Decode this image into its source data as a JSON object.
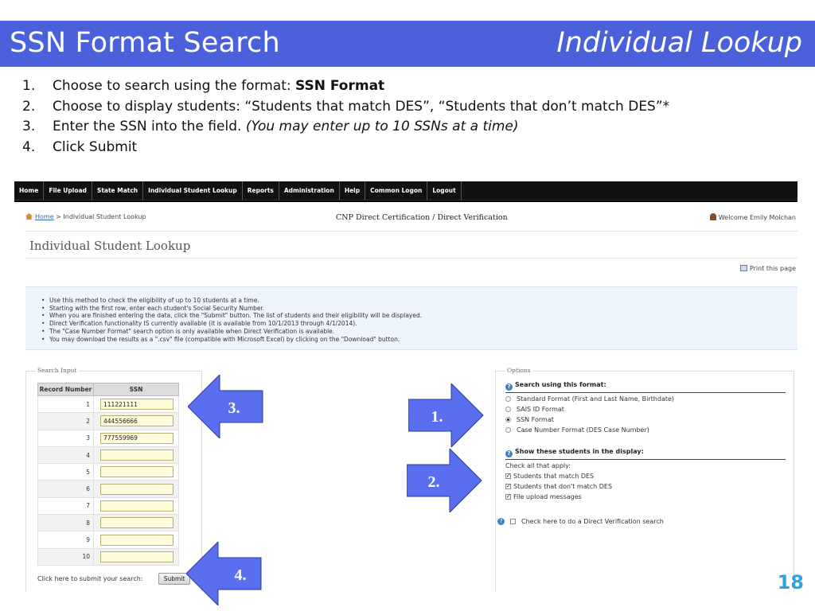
{
  "slide": {
    "title_left": "SSN Format Search",
    "title_right": "Individual Lookup",
    "page_number": "18",
    "accent_color": "#4a61db"
  },
  "steps": [
    {
      "num": "1.",
      "text": "Choose to search using the format: ",
      "bold": "SSN Format"
    },
    {
      "num": "2.",
      "text": "Choose to display students: “Students that match DES”, “Students that don’t match DES”*"
    },
    {
      "num": "3.",
      "text": "Enter the SSN into the field. ",
      "italic": "(You may enter up to 10 SSNs at a time)"
    },
    {
      "num": "4.",
      "text": "Click Submit"
    }
  ],
  "app": {
    "nav": [
      "Home",
      "File Upload",
      "State Match",
      "Individual Student Lookup",
      "Reports",
      "Administration",
      "Help",
      "Common Logon",
      "Logout"
    ],
    "breadcrumb": {
      "home": "Home",
      "separator": " > ",
      "current": "Individual Student Lookup"
    },
    "center_title": "CNP Direct Certification / Direct Verification",
    "welcome": "Welcome Emily Molchan",
    "page_heading": "Individual Student Lookup",
    "print_label": "Print this page",
    "info_bullets": [
      "Use this method to check the eligibility of up to 10 students at a time.",
      "Starting with the first row, enter each student's Social Security Number.",
      "When you are finished entering the data, click the \"Submit\" button. The list of students and their eligibility will be displayed.",
      "Direct Verification functionality IS currently available (it is available from 10/1/2013 through 4/1/2014).",
      "The \"Case Number Format\" search option is only available when Direct Verification is available.",
      "You may download the results as a \".csv\" file (compatible with Microsoft Excel) by clicking on the \"Download\" button."
    ],
    "search_input": {
      "legend": "Search Input",
      "col_record": "Record Number",
      "col_ssn": "SSN",
      "rows": [
        {
          "num": "1",
          "ssn": "111221111"
        },
        {
          "num": "2",
          "ssn": "444556666"
        },
        {
          "num": "3",
          "ssn": "777559969"
        },
        {
          "num": "4",
          "ssn": ""
        },
        {
          "num": "5",
          "ssn": ""
        },
        {
          "num": "6",
          "ssn": ""
        },
        {
          "num": "7",
          "ssn": ""
        },
        {
          "num": "8",
          "ssn": ""
        },
        {
          "num": "9",
          "ssn": ""
        },
        {
          "num": "10",
          "ssn": ""
        }
      ],
      "submit_prompt": "Click here to submit your search:",
      "submit_label": "Submit"
    },
    "options": {
      "legend": "Options",
      "format_heading": "Search using this format:",
      "formats": [
        {
          "label": "Standard Format (First and Last Name, Birthdate)",
          "selected": false
        },
        {
          "label": "SAIS ID Format",
          "selected": false
        },
        {
          "label": "SSN Format",
          "selected": true
        },
        {
          "label": "Case Number Format (DES Case Number)",
          "selected": false
        }
      ],
      "display_heading": "Show these students in the display:",
      "check_all": "Check all that apply:",
      "display_options": [
        {
          "label": "Students that match DES",
          "checked": true
        },
        {
          "label": "Students that don't match DES",
          "checked": true
        },
        {
          "label": "File upload messages",
          "checked": true
        }
      ],
      "dv_label": "Check here to do a Direct Verification search",
      "dv_checked": false
    }
  },
  "callouts": {
    "one": "1.",
    "two": "2.",
    "three": "3.",
    "four": "4.",
    "fill_color": "#5a6ef0"
  }
}
